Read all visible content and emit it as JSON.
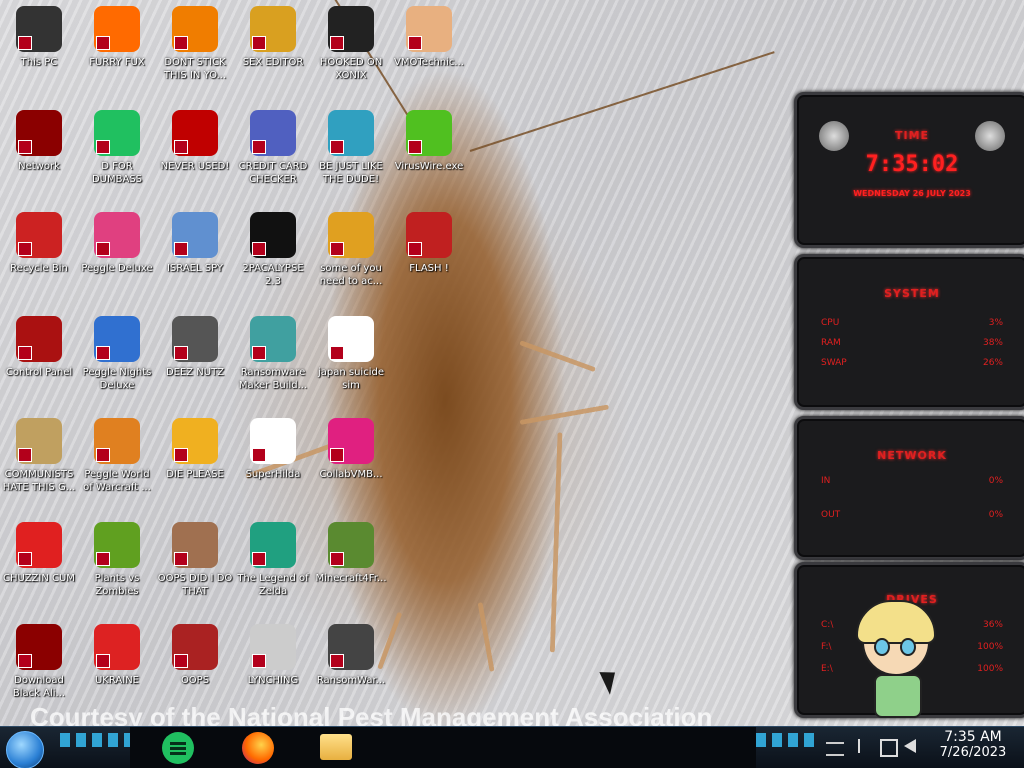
{
  "desktop": {
    "icons": [
      {
        "label": "This PC",
        "icon": "computer-icon",
        "color": "#333333"
      },
      {
        "label": "FURRY FUX",
        "icon": "firefox-icon",
        "color": "#ff6a00"
      },
      {
        "label": "DONT STICK THIS IN YO...",
        "icon": "vlc-cone-icon",
        "color": "#f07d00"
      },
      {
        "label": "SEX EDITOR",
        "icon": "hxd-editor-icon",
        "color": "#d9a020"
      },
      {
        "label": "HOOKED ON XONIX",
        "icon": "xonix-game-icon",
        "color": "#222222"
      },
      {
        "label": "VMOTechnic...",
        "icon": "technician-person-icon",
        "color": "#e8b080"
      },
      {
        "label": "Network",
        "icon": "alien-network-icon",
        "color": "#8b0000"
      },
      {
        "label": "D FOR DUMBASS",
        "icon": "chat-app-icon",
        "color": "#20c060"
      },
      {
        "label": "NEVER USED!",
        "icon": "devcpp-icon",
        "color": "#c00000"
      },
      {
        "label": "CREDIT CARD CHECKER",
        "icon": "credit-card-icon",
        "color": "#5060c0"
      },
      {
        "label": "BE JUST LIKE THE DUDE!",
        "icon": "santa-character-icon",
        "color": "#30a0c0"
      },
      {
        "label": "VirusWire.exe",
        "icon": "lime-wheel-icon",
        "color": "#50c020"
      },
      {
        "label": "Recycle Bin",
        "icon": "recycle-bin-icon",
        "color": "#cc2222"
      },
      {
        "label": "Peggle Deluxe",
        "icon": "peggle-icon",
        "color": "#e04080"
      },
      {
        "label": "ISRAEL SPY",
        "icon": "spy-network-icon",
        "color": "#6090d0"
      },
      {
        "label": "2PACALYPSE 2.3",
        "icon": "terminal-icon",
        "color": "#111111"
      },
      {
        "label": "some of you need to ac...",
        "icon": "dog-cartoon-icon",
        "color": "#e0a020"
      },
      {
        "label": "FLASH !",
        "icon": "flash-icon",
        "color": "#c02020"
      },
      {
        "label": "Control Panel",
        "icon": "control-panel-icon",
        "color": "#aa1111"
      },
      {
        "label": "Peggle Nights Deluxe",
        "icon": "peggle-nights-icon",
        "color": "#3070d0"
      },
      {
        "label": "DEEZ NUTZ",
        "icon": "stacked-windows-icon",
        "color": "#555555"
      },
      {
        "label": "Ransomware Maker Build...",
        "icon": "window-app-icon",
        "color": "#40a0a0"
      },
      {
        "label": "japan suicide sim",
        "icon": "arrows-game-icon",
        "color": "#ffffff"
      },
      {
        "label": "COMMUNISTS HATE THIS G...",
        "icon": "money-bag-icon",
        "color": "#c0a060"
      },
      {
        "label": "Peggle World of Warcraft ...",
        "icon": "peggle-wow-icon",
        "color": "#e08020"
      },
      {
        "label": "DIE PLEASE",
        "icon": "adobe-de-icon",
        "color": "#f0b020"
      },
      {
        "label": "SuperHilda",
        "icon": "pixel-cat-icon",
        "color": "#ffffff"
      },
      {
        "label": "CollabVMB...",
        "icon": "collabvm-icon",
        "color": "#e02080"
      },
      {
        "label": "CHUZZIN CUM",
        "icon": "chuzzle-icon",
        "color": "#e02020"
      },
      {
        "label": "Plants vs Zombies",
        "icon": "pvz-flower-icon",
        "color": "#60a020"
      },
      {
        "label": "OOPS DID I DO THAT",
        "icon": "portrait-painting-icon",
        "color": "#a07050"
      },
      {
        "label": "The Legend of Zelda",
        "icon": "pixel-hero-icon",
        "color": "#20a080"
      },
      {
        "label": "Minecraft4Fr...",
        "icon": "minecraft-block-icon",
        "color": "#5a8a30"
      },
      {
        "label": "Download Black Ali...",
        "icon": "alien-download-icon",
        "color": "#8b0000"
      },
      {
        "label": "UKRAINE",
        "icon": "radiation-icon",
        "color": "#dd2222"
      },
      {
        "label": "OOPS",
        "icon": "monitor-red-icon",
        "color": "#aa2222"
      },
      {
        "label": "LYNCHING",
        "icon": "rope-icon",
        "color": "#cccccc"
      },
      {
        "label": "RansomWar...",
        "icon": "skull-icon",
        "color": "#444444"
      }
    ],
    "watermark": "Courtesy of the National Pest Management Association"
  },
  "gadgets": {
    "time": {
      "title": "TIME",
      "clock": "7:35:02",
      "date": "WEDNESDAY 26 JULY 2023"
    },
    "system": {
      "title": "SYSTEM",
      "rows": [
        {
          "name": "CPU",
          "value": "3%"
        },
        {
          "name": "RAM",
          "value": "38%"
        },
        {
          "name": "SWAP",
          "value": "26%"
        }
      ]
    },
    "network": {
      "title": "NETWORK",
      "rows": [
        {
          "name": "IN",
          "value": "0%"
        },
        {
          "name": "OUT",
          "value": "0%"
        }
      ]
    },
    "drives": {
      "title": "DRIVES",
      "rows": [
        {
          "name": "C:\\",
          "value": "36%"
        },
        {
          "name": "F:\\",
          "value": "100%"
        },
        {
          "name": "E:\\",
          "value": "100%"
        }
      ]
    }
  },
  "taskbar": {
    "start": "start-orb-icon",
    "apps": [
      {
        "icon": "chat-app-icon",
        "color": "#20c060"
      },
      {
        "icon": "firefox-icon",
        "color": "#ff6a00"
      },
      {
        "icon": "file-explorer-icon",
        "color": "#f0c040"
      }
    ],
    "time": "7:35 AM",
    "date": "7/26/2023"
  },
  "colors": {
    "accent_red": "#e02020",
    "taskbar": "#0d1a26"
  }
}
